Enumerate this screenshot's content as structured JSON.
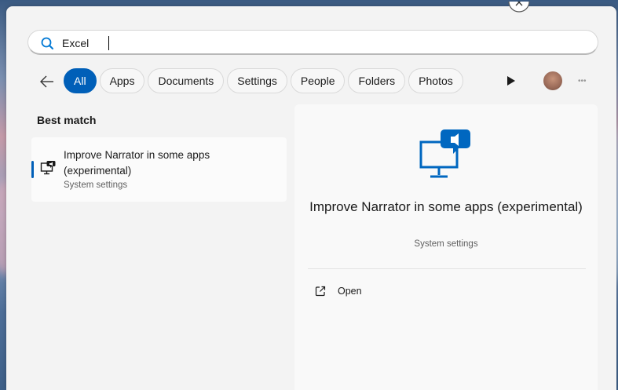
{
  "search": {
    "value": "Excel",
    "placeholder": ""
  },
  "filters": [
    {
      "label": "All",
      "active": true
    },
    {
      "label": "Apps",
      "active": false
    },
    {
      "label": "Documents",
      "active": false
    },
    {
      "label": "Settings",
      "active": false
    },
    {
      "label": "People",
      "active": false
    },
    {
      "label": "Folders",
      "active": false
    },
    {
      "label": "Photos",
      "active": false
    }
  ],
  "best_match": {
    "section_label": "Best match",
    "title": "Improve Narrator in some apps (experimental)",
    "subtitle": "System settings",
    "icon": "narrator-monitor-icon"
  },
  "detail": {
    "title": "Improve Narrator in some apps (experimental)",
    "subtitle": "System settings",
    "icon": "narrator-monitor-icon",
    "actions": [
      {
        "label": "Open",
        "icon": "open-external-icon"
      }
    ]
  },
  "colors": {
    "accent": "#005fb8",
    "panel": "#f3f3f3",
    "detail_bg": "#f9f9f9",
    "icon_blue": "#0067c0"
  }
}
